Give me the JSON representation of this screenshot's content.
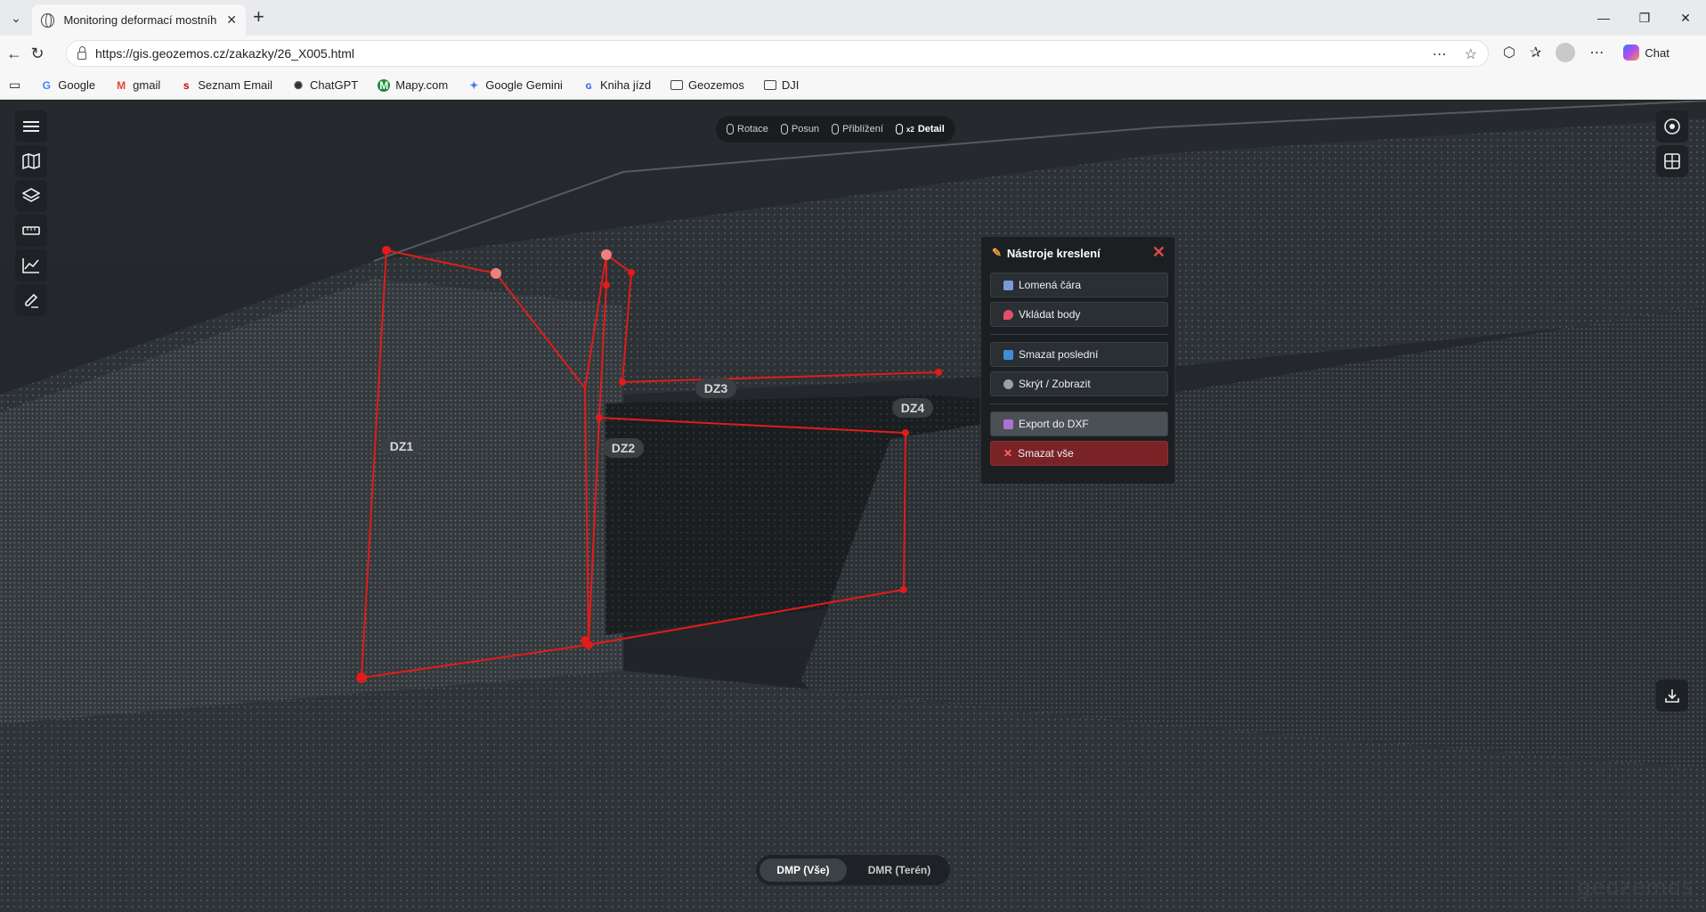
{
  "browser": {
    "tab_title": "Monitoring deformací mostního o",
    "url": "https://gis.geozemos.cz/zakazky/26_X005.html",
    "chat_label": "Chat",
    "bookmarks": [
      {
        "label": "Google",
        "icon": "google-icon",
        "color": "#4285f4"
      },
      {
        "label": "gmail",
        "icon": "gmail-icon",
        "color": "#ea4335"
      },
      {
        "label": "Seznam Email",
        "icon": "seznam-icon",
        "color": "#cc0000"
      },
      {
        "label": "ChatGPT",
        "icon": "chatgpt-icon",
        "color": "#333333"
      },
      {
        "label": "Mapy.com",
        "icon": "mapy-icon",
        "color": "#1e8c3a"
      },
      {
        "label": "Google Gemini",
        "icon": "gemini-icon",
        "color": "#4b7bec"
      },
      {
        "label": "Kniha jízd",
        "icon": "kniha-icon",
        "color": "#3a6fd8"
      },
      {
        "label": "Geozemos",
        "icon": "folder-icon",
        "color": "#444444"
      },
      {
        "label": "DJI",
        "icon": "folder-icon",
        "color": "#444444"
      }
    ]
  },
  "nav_modes": [
    {
      "label": "Rotace",
      "active": false
    },
    {
      "label": "Posun",
      "active": false
    },
    {
      "label": "Přiblížení",
      "active": false
    },
    {
      "label": "Detail",
      "active": true,
      "prefix": "x2"
    }
  ],
  "drawing_panel": {
    "title": "Nástroje kreslení",
    "buttons": {
      "polyline": "Lomená čára",
      "points": "Vkládat body",
      "undo": "Smazat poslední",
      "toggle": "Skrýt / Zobrazit",
      "export": "Export do DXF",
      "clear": "Smazat vše"
    }
  },
  "zone_labels": [
    "DZ1",
    "DZ2",
    "DZ3",
    "DZ4"
  ],
  "layers": {
    "dmp": "DMP (Vše)",
    "dmr": "DMR (Terén)",
    "active": "DMP (Vše)"
  },
  "watermark": "geozemos",
  "colors": {
    "drawing_red": "#e21b1b",
    "panel_bg": "#1b1f22",
    "delete_bg": "#7a2327"
  }
}
